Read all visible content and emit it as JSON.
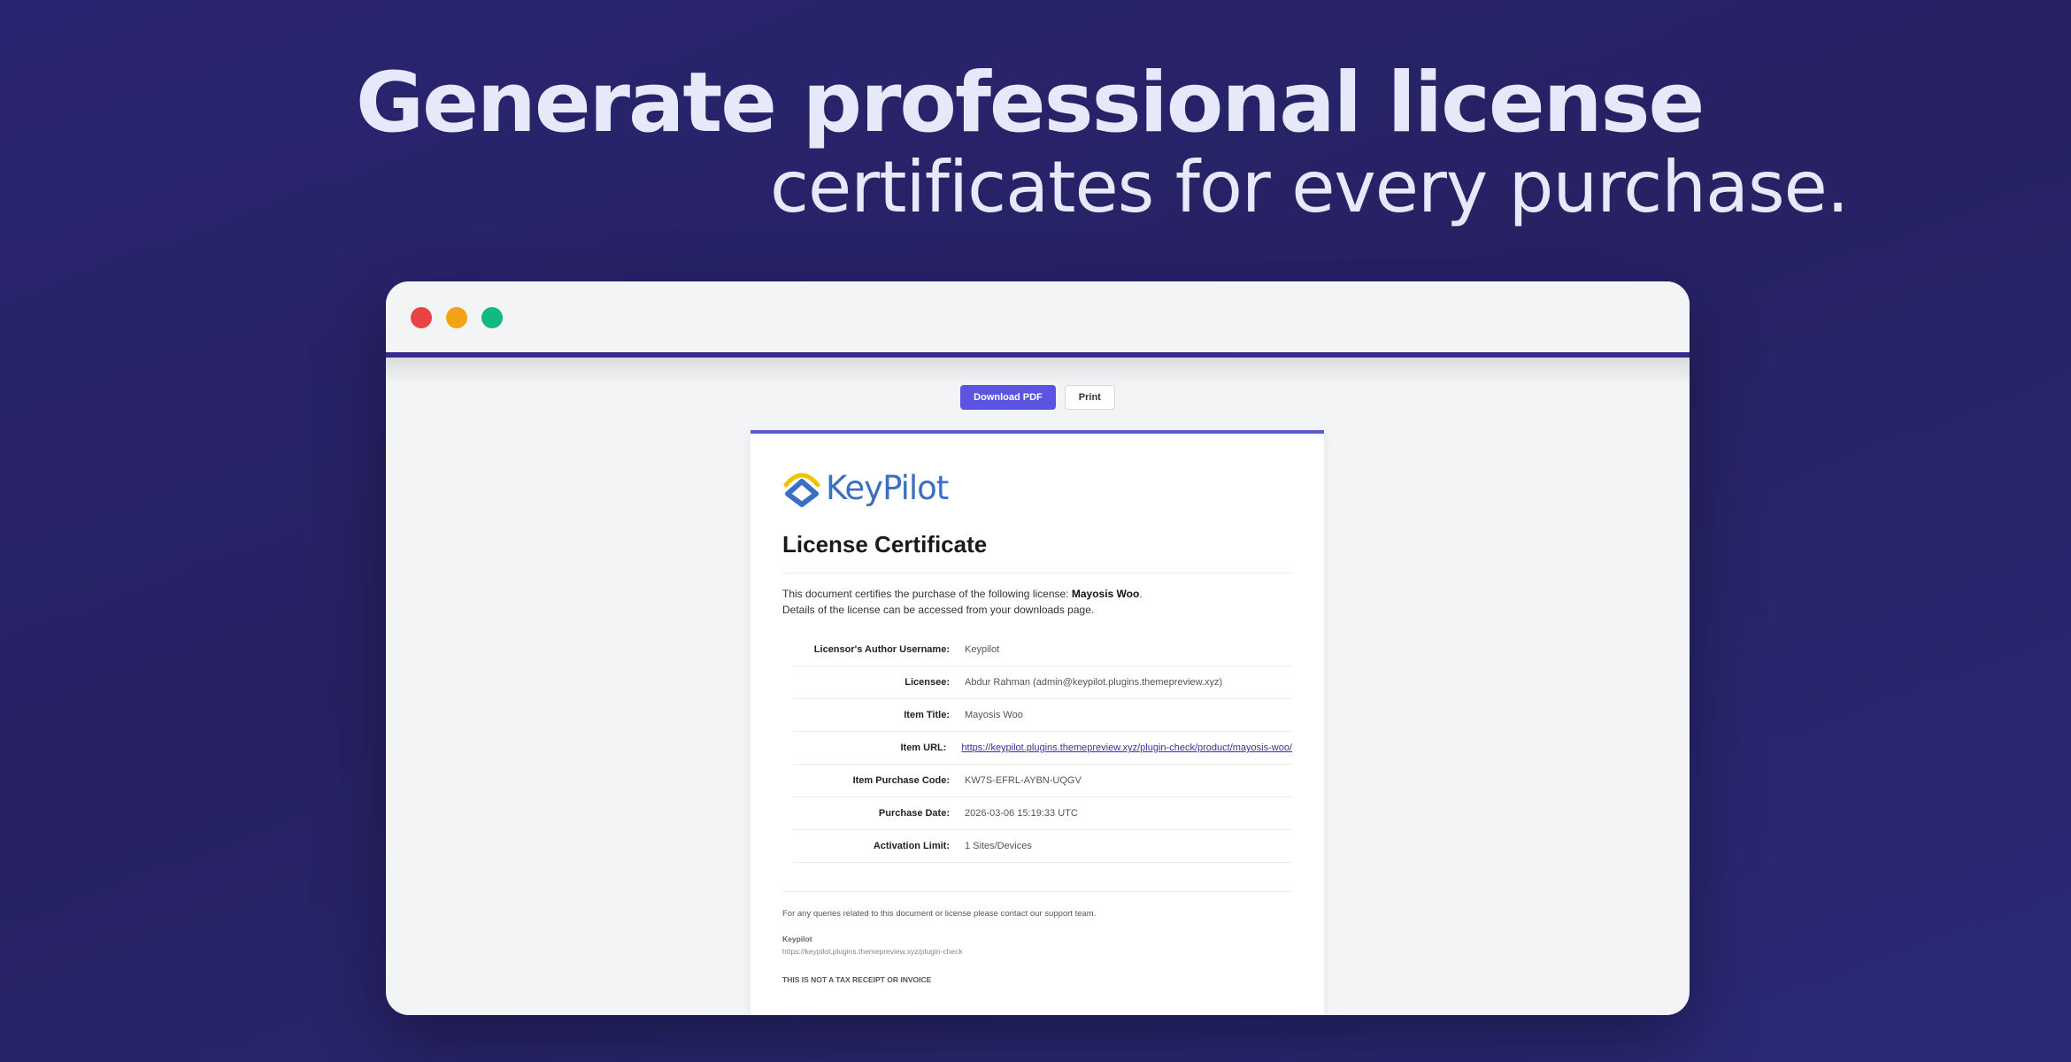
{
  "hero": {
    "headline": "Generate professional license",
    "subline": "certificates for every purchase."
  },
  "window": {
    "controls": [
      "close",
      "minimize",
      "maximize"
    ],
    "accent": "#3a2a8a"
  },
  "actions": {
    "download_label": "Download PDF",
    "print_label": "Print",
    "primary_color": "#5b54e0"
  },
  "certificate": {
    "logo_text": "KeyPilot",
    "title": "License Certificate",
    "intro_prefix": "This document certifies the purchase of the following license: ",
    "intro_product": "Mayosis Woo",
    "intro_suffix": ".",
    "intro_line2": "Details of the license can be accessed from your downloads page.",
    "fields": [
      {
        "label": "Licensor's Author Username:",
        "value": "Keypilot"
      },
      {
        "label": "Licensee:",
        "value": "Abdur Rahman (admin@keypilot.plugins.themepreview.xyz)"
      },
      {
        "label": "Item Title:",
        "value": "Mayosis Woo"
      },
      {
        "label": "Item URL:",
        "value": "https://keypilot.plugins.themepreview.xyz/plugin-check/product/mayosis-woo/"
      },
      {
        "label": "Item Purchase Code:",
        "value": "KW7S-EFRL-AYBN-UQGV"
      },
      {
        "label": "Purchase Date:",
        "value": "2026-03-06 15:19:33 UTC"
      },
      {
        "label": "Activation Limit:",
        "value": "1 Sites/Devices"
      }
    ],
    "footer": {
      "support_note": "For any queries related to this document or license please contact our support team.",
      "company": "Keypilot",
      "company_url": "https://keypilot.plugins.themepreview.xyz/plugin-check",
      "disclaimer": "THIS IS NOT A TAX RECEIPT OR INVOICE"
    }
  }
}
